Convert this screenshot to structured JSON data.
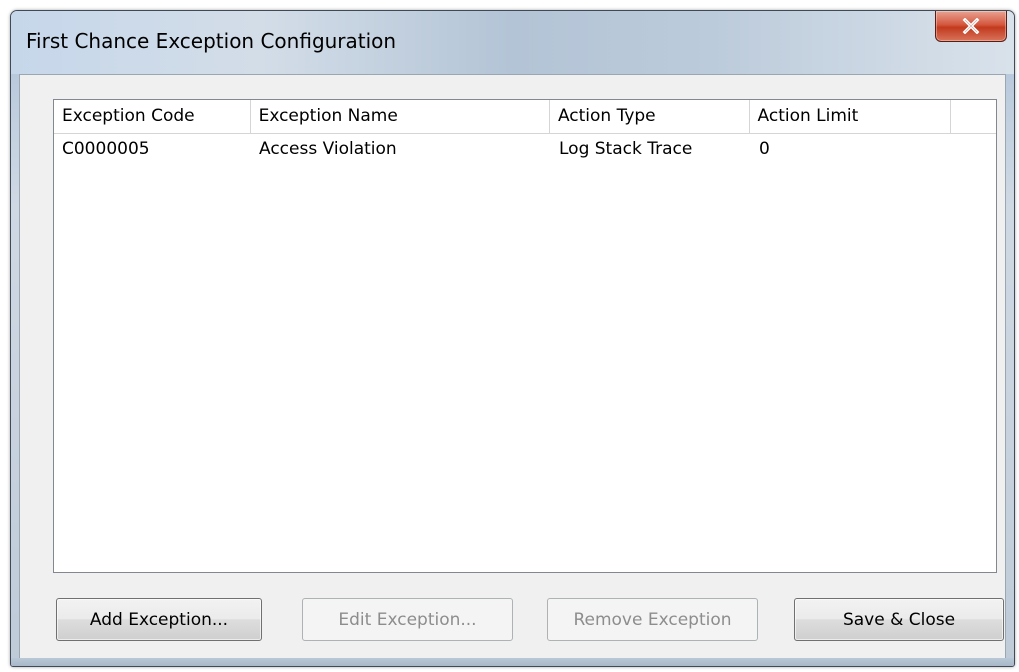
{
  "window": {
    "title": "First Chance Exception Configuration"
  },
  "table": {
    "columns": [
      "Exception Code",
      "Exception Name",
      "Action Type",
      "Action Limit",
      ""
    ],
    "rows": [
      {
        "code": "C0000005",
        "name": "Access Violation",
        "action_type": "Log Stack Trace",
        "action_limit": "0"
      }
    ]
  },
  "buttons": {
    "add": "Add Exception...",
    "edit": "Edit Exception...",
    "remove": "Remove Exception",
    "save": "Save & Close"
  },
  "icons": {
    "close": "close-icon"
  },
  "colors": {
    "close_button": "#c8432a",
    "disabled_text": "#8d8d8d"
  }
}
